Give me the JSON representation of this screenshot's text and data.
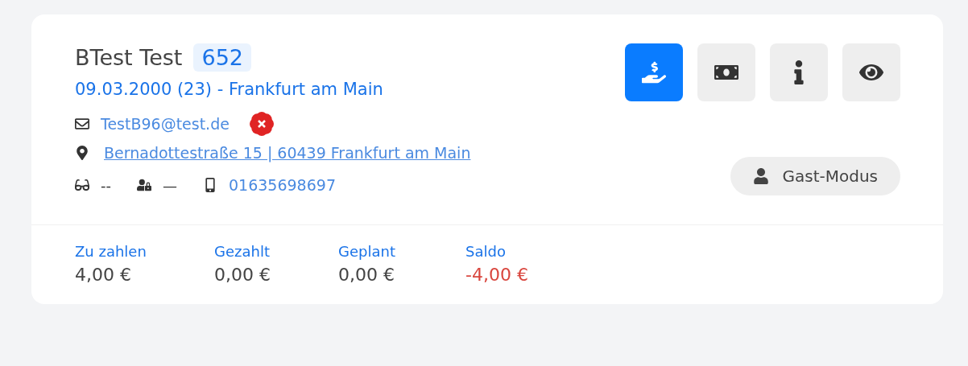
{
  "customer": {
    "name": "BTest Test",
    "number": "652",
    "subtitle": "09.03.2000 (23) - Frankfurt am Main"
  },
  "email": {
    "address": "TestB96@test.de",
    "verified": false
  },
  "address": "Bernadottestraße 15 | 60439 Frankfurt am Main",
  "details": [
    {
      "kind": "glasses",
      "value": "--"
    },
    {
      "kind": "lock",
      "value": "—"
    },
    {
      "kind": "phone",
      "value": "01635698697"
    }
  ],
  "actions": [
    {
      "kind": "payment",
      "selected": true
    },
    {
      "kind": "money",
      "selected": false
    },
    {
      "kind": "info",
      "selected": false
    },
    {
      "kind": "view",
      "selected": false
    }
  ],
  "guest_button": "Gast-Modus",
  "summary": [
    {
      "label": "Zu zahlen",
      "value": "4,00 €",
      "kind": "normal"
    },
    {
      "label": "Gezahlt",
      "value": "0,00 €",
      "kind": "normal"
    },
    {
      "label": "Geplant",
      "value": "0,00 €",
      "kind": "normal"
    },
    {
      "label": "Saldo",
      "value": "-4,00 €",
      "kind": "negative"
    }
  ]
}
